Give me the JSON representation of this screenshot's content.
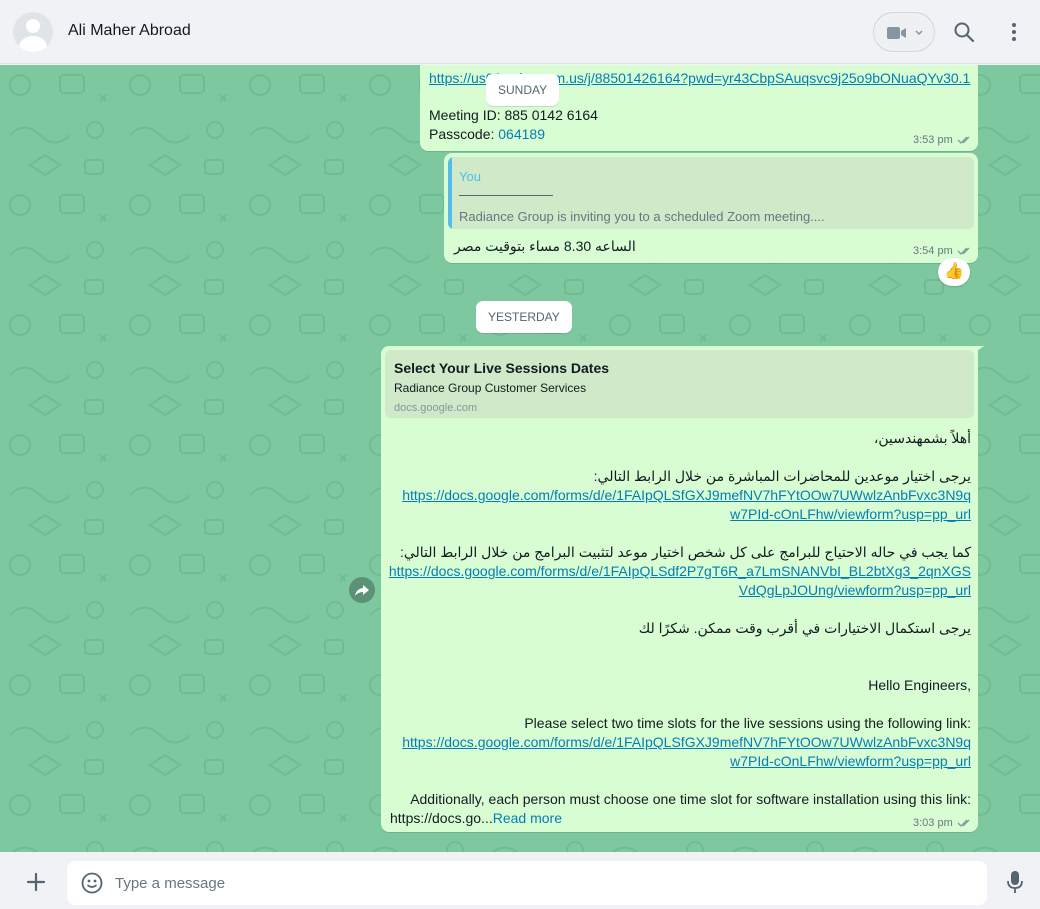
{
  "header": {
    "contact_name": "Ali Maher Abroad"
  },
  "messages": {
    "m1": {
      "link_visible": "https://us06web.zoom.us/j/88501426164?pwd=yr43CbpSAuqsvc9j25o9bONuaQYv30.1",
      "meeting_id": "Meeting ID: 885 0142 6164",
      "passcode_label": "Passcode: ",
      "passcode": "064189",
      "time": "3:53 pm"
    },
    "date_sunday": "SUNDAY",
    "m2": {
      "quote_author": "You",
      "quote_rule": "——————",
      "quote_text": "Radiance Group is inviting you to a scheduled Zoom meeting....",
      "text": "الساعه 8.30 مساء بتوقيت مصر",
      "time": "3:54 pm",
      "reaction": "👍"
    },
    "date_yesterday": "YESTERDAY",
    "m3": {
      "preview_title": "Select Your Live Sessions Dates",
      "preview_subtitle": "Radiance Group Customer Services",
      "preview_domain": "docs.google.com",
      "ar_greeting": "أهلاً بشمهندسين،",
      "ar_line1": "يرجى اختيار موعدين للمحاضرات المباشرة من خلال الرابط التالي:",
      "link1_a": "https://docs.google.com/forms/d/e/1FAIpQLSfGXJ9mefNV7hFYtOOw7UWwlzAnbFvxc3N9q",
      "link1_b": "w7PId-cOnLFhw/viewform?usp=pp_url",
      "ar_line2": "كما يجب في حاله الاحتياج للبرامج على كل شخص اختيار موعد لتثبيت  البرامج من خلال الرابط التالي:",
      "link2_a": "https://docs.google.com/forms/d/e/1FAIpQLSdf2P7gT6R_a7LmSNANVbI_BL2btXg3_2qnXGS",
      "link2_b": "VdQgLpJOUng/viewform?usp=pp_url",
      "ar_line3": "يرجى استكمال الاختيارات في أقرب وقت ممكن. شكرًا لك",
      "en_greeting": "Hello Engineers,",
      "en_line1": "Please select two time slots for the live sessions using the following link:",
      "link3_a": "https://docs.google.com/forms/d/e/1FAIpQLSfGXJ9mefNV7hFYtOOw7UWwlzAnbFvxc3N9q",
      "link3_b": "w7PId-cOnLFhw/viewform?usp=pp_url",
      "en_line2": "Additionally, each person must choose one time slot for software installation using this link:",
      "en_trunc": "https://docs.go...",
      "read_more": "Read more",
      "time": "3:03 pm"
    }
  },
  "composer": {
    "placeholder": "Type a message"
  },
  "colors": {
    "chat_bg": "#7ec8a0",
    "bubble_out": "#d9fdd3",
    "link": "#027eb5",
    "read_tick": "#8696a0"
  }
}
